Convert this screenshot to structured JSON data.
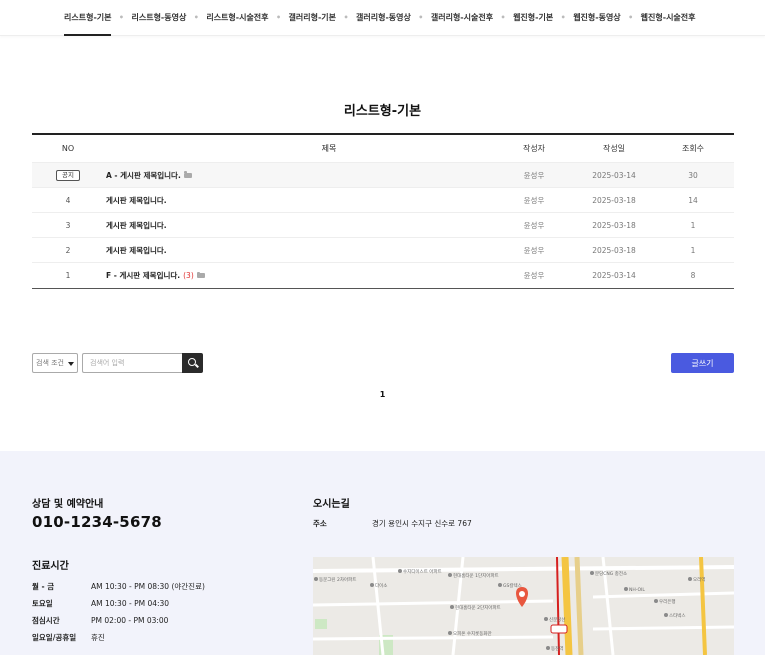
{
  "nav": {
    "tabs": [
      {
        "label": "리스트형-기본",
        "active": true
      },
      {
        "label": "리스트형-동영상"
      },
      {
        "label": "리스트형-시술전후"
      },
      {
        "label": "갤러리형-기본"
      },
      {
        "label": "갤러리형-동영상"
      },
      {
        "label": "갤러리형-시술전후"
      },
      {
        "label": "웹진형-기본"
      },
      {
        "label": "웹진형-동영상"
      },
      {
        "label": "웹진형-시술전후"
      }
    ],
    "separator": "•"
  },
  "page": {
    "title": "리스트형-기본"
  },
  "board": {
    "headers": {
      "no": "NO",
      "title": "제목",
      "author": "작성자",
      "date": "작성일",
      "views": "조회수"
    },
    "notice_label": "공지",
    "rows": [
      {
        "no": "공지",
        "title": "A - 게시판 제목입니다.",
        "attachment": true,
        "comments": "",
        "author": "윤성우",
        "date": "2025-03-14",
        "views": "30"
      },
      {
        "no": "4",
        "title": "게시판 제목입니다.",
        "attachment": false,
        "comments": "",
        "author": "윤성우",
        "date": "2025-03-18",
        "views": "14"
      },
      {
        "no": "3",
        "title": "게시판 제목입니다.",
        "attachment": false,
        "comments": "",
        "author": "윤성우",
        "date": "2025-03-18",
        "views": "1"
      },
      {
        "no": "2",
        "title": "게시판 제목입니다.",
        "attachment": false,
        "comments": "",
        "author": "윤성우",
        "date": "2025-03-18",
        "views": "1"
      },
      {
        "no": "1",
        "title": "F - 게시판 제목입니다.",
        "attachment": true,
        "comments": "(3)",
        "author": "윤성우",
        "date": "2025-03-14",
        "views": "8"
      }
    ]
  },
  "search": {
    "select_value": "검색 조건",
    "placeholder": "검색어 입력"
  },
  "write_button": "글쓰기",
  "pagination": {
    "current": "1"
  },
  "footer": {
    "consult_label": "상담 및 예약안내",
    "phone": "010-1234-5678",
    "hours_label": "진료시간",
    "hours": [
      {
        "day": "월 - 금",
        "time": "AM 10:30 - PM 08:30 (야간진료)"
      },
      {
        "day": "토요일",
        "time": "AM 10:30 - PM 04:30"
      },
      {
        "day": "점심시간",
        "time": "PM 02:00 - PM 03:00"
      },
      {
        "day": "일요일/공휴일",
        "time": "휴진"
      }
    ],
    "map_label": "오시는길",
    "address_label": "주소",
    "address": "경기 용인시 수지구 신수로 767"
  },
  "map": {
    "labels": [
      {
        "text": "동문그린 2차아파트"
      },
      {
        "text": "다이소"
      },
      {
        "text": "수지디이스트 아파트"
      },
      {
        "text": "현대홈타운 1단지아파트"
      },
      {
        "text": "GS칼텍스"
      },
      {
        "text": "현대홈타운 2단지아파트"
      },
      {
        "text": "오피온 수지롯동화만"
      },
      {
        "text": "동천역"
      },
      {
        "text": "신분당선"
      },
      {
        "text": "분당CNG 충전소"
      },
      {
        "text": "NH-OIL"
      },
      {
        "text": "우리은행"
      },
      {
        "text": "스타벅스"
      },
      {
        "text": "오리역"
      }
    ],
    "colors": {
      "bg": "#eceae6",
      "road": "#ffffff",
      "highway": "#f4c542",
      "subway": "#d6201f",
      "green": "#cde8c4",
      "pin": "#e8573f"
    }
  },
  "colors": {
    "accent": "#4a5ae0",
    "footer_bg": "#f2f3fb",
    "comment": "#e03131"
  }
}
